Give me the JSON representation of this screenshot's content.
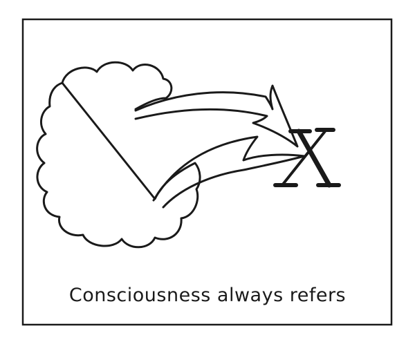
{
  "caption": "Consciousness always refers",
  "target_label": "X",
  "colors": {
    "ink": "#1a1a1a",
    "paper": "#ffffff"
  }
}
